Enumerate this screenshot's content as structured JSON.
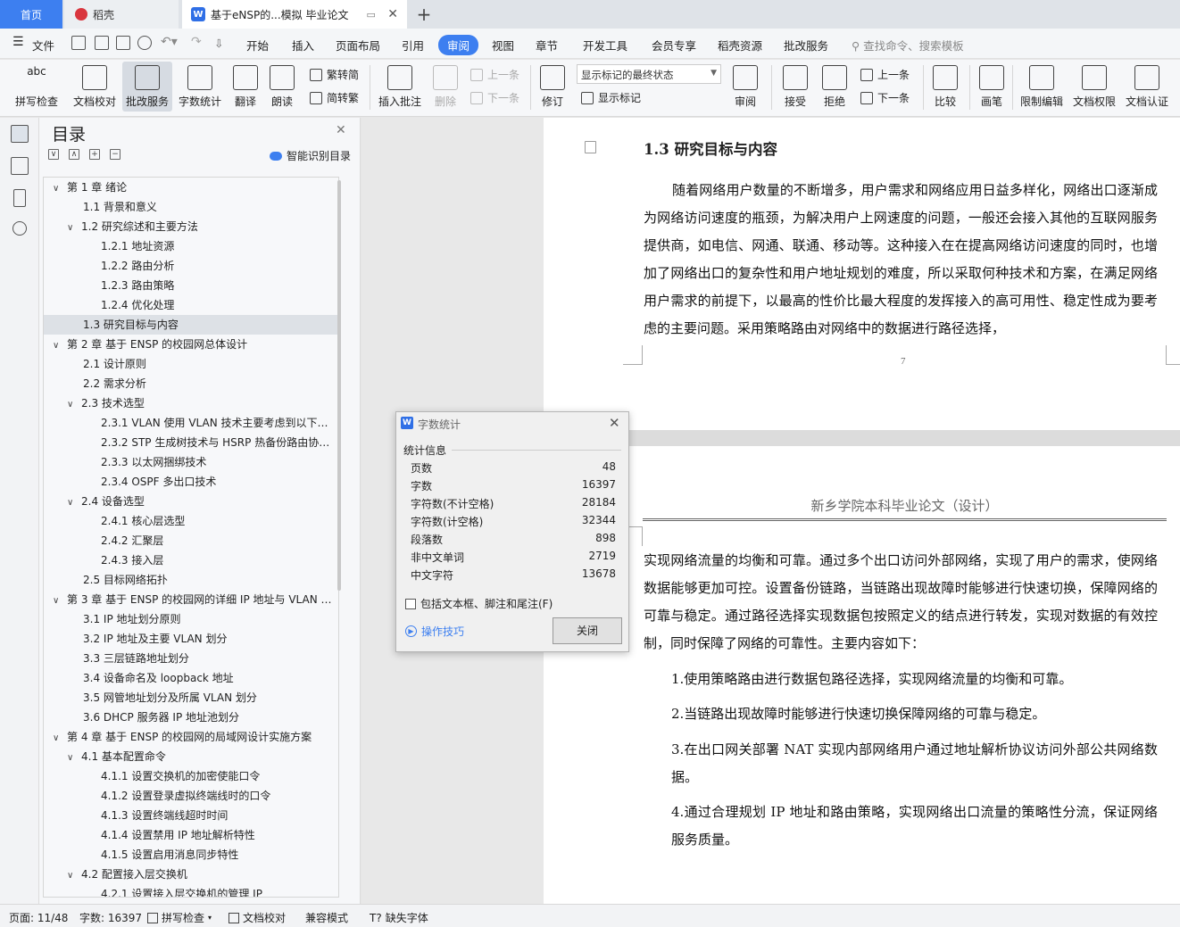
{
  "titlebar": {
    "home_tab": "首页",
    "daoke_tab": "稻壳",
    "doc_tab": "基于eNSP的...模拟 毕业论文",
    "plus": "+"
  },
  "menubar": {
    "file": "文件",
    "items": [
      "开始",
      "插入",
      "页面布局",
      "引用",
      "审阅",
      "视图",
      "章节",
      "开发工具",
      "会员专享",
      "稻壳资源",
      "批改服务"
    ],
    "active": "审阅",
    "search": "查找命令、搜索模板"
  },
  "ribbon": {
    "spell_check": "拼写检查",
    "doc_proof": "文档校对",
    "review_service": "批改服务",
    "word_count": "字数统计",
    "translate": "翻译",
    "read_aloud": "朗读",
    "trad_to_simp": "繁转简",
    "simp_to_trad": "简转繁",
    "insert_comment": "插入批注",
    "delete": "删除",
    "prev_comment": "上一条",
    "next_comment": "下一条",
    "revise": "修订",
    "markup_state": "显示标记的最终状态",
    "show_markup": "显示标记",
    "review": "审阅",
    "accept": "接受",
    "reject": "拒绝",
    "prev_change": "上一条",
    "next_change": "下一条",
    "compare": "比较",
    "pen": "画笔",
    "restrict_edit": "限制编辑",
    "doc_rights": "文档权限",
    "doc_cert": "文档认证"
  },
  "toc": {
    "title": "目录",
    "smart": "智能识别目录",
    "items": [
      {
        "level": 1,
        "text": "第 1 章  绪论",
        "chev": "∨"
      },
      {
        "level": 2,
        "text": "1.1 背景和意义",
        "chev": ""
      },
      {
        "level": 2,
        "text": "1.2 研究综述和主要方法",
        "chev": "∨"
      },
      {
        "level": 3,
        "text": "1.2.1 地址资源",
        "chev": ""
      },
      {
        "level": 3,
        "text": "1.2.2 路由分析",
        "chev": ""
      },
      {
        "level": 3,
        "text": "1.2.3 路由策略",
        "chev": ""
      },
      {
        "level": 3,
        "text": "1.2.4 优化处理",
        "chev": ""
      },
      {
        "level": 2,
        "text": "1.3 研究目标与内容",
        "chev": "",
        "selected": true
      },
      {
        "level": 1,
        "text": "第 2 章  基于 ENSP 的校园网总体设计",
        "chev": "∨"
      },
      {
        "level": 2,
        "text": "2.1 设计原则",
        "chev": ""
      },
      {
        "level": 2,
        "text": "2.2 需求分析",
        "chev": ""
      },
      {
        "level": 2,
        "text": "2.3 技术选型",
        "chev": "∨"
      },
      {
        "level": 3,
        "text": "2.3.1 VLAN  使用 VLAN 技术主要考虑到以下优势：",
        "chev": ""
      },
      {
        "level": 3,
        "text": "2.3.2 STP 生成树技术与 HSRP 热备份路由协议技术",
        "chev": ""
      },
      {
        "level": 3,
        "text": "2.3.3 以太网捆绑技术",
        "chev": ""
      },
      {
        "level": 3,
        "text": "2.3.4 OSPF 多出口技术",
        "chev": ""
      },
      {
        "level": 2,
        "text": "2.4 设备选型",
        "chev": "∨"
      },
      {
        "level": 3,
        "text": "2.4.1 核心层选型",
        "chev": ""
      },
      {
        "level": 3,
        "text": "2.4.2 汇聚层",
        "chev": ""
      },
      {
        "level": 3,
        "text": "2.4.3 接入层",
        "chev": ""
      },
      {
        "level": 2,
        "text": "2.5 目标网络拓扑",
        "chev": ""
      },
      {
        "level": 1,
        "text": "第 3 章  基于 ENSP 的校园网的详细 IP 地址与 VLAN 划分",
        "chev": "∨"
      },
      {
        "level": 2,
        "text": "3.1 IP 地址划分原则",
        "chev": ""
      },
      {
        "level": 2,
        "text": "3.2 IP 地址及主要 VLAN 划分",
        "chev": ""
      },
      {
        "level": 2,
        "text": "3.3 三层链路地址划分",
        "chev": ""
      },
      {
        "level": 2,
        "text": "3.4 设备命名及 loopback 地址",
        "chev": ""
      },
      {
        "level": 2,
        "text": "3.5 网管地址划分及所属 VLAN 划分",
        "chev": ""
      },
      {
        "level": 2,
        "text": "3.6 DHCP 服务器 IP 地址池划分",
        "chev": ""
      },
      {
        "level": 1,
        "text": "第 4 章  基于 ENSP 的校园网的局域网设计实施方案",
        "chev": "∨"
      },
      {
        "level": 2,
        "text": "4.1 基本配置命令",
        "chev": "∨"
      },
      {
        "level": 3,
        "text": "4.1.1 设置交换机的加密使能口令",
        "chev": ""
      },
      {
        "level": 3,
        "text": "4.1.2 设置登录虚拟终端线时的口令",
        "chev": ""
      },
      {
        "level": 3,
        "text": "4.1.3 设置终端线超时时间",
        "chev": ""
      },
      {
        "level": 3,
        "text": "4.1.4 设置禁用 IP 地址解析特性",
        "chev": ""
      },
      {
        "level": 3,
        "text": "4.1.5 设置启用消息同步特性",
        "chev": ""
      },
      {
        "level": 2,
        "text": "4.2 配置接入层交换机",
        "chev": "∨"
      },
      {
        "level": 3,
        "text": "4.2.1 设置接入层交换机的管理 IP",
        "chev": ""
      }
    ]
  },
  "document": {
    "heading": "1.3 研究目标与内容",
    "para1": "随着网络用户数量的不断增多，用户需求和网络应用日益多样化，网络出口逐渐成为网络访问速度的瓶颈，为解决用户上网速度的问题，一般还会接入其他的互联网服务提供商，如电信、网通、联通、移动等。这种接入在在提高网络访问速度的同时，也增加了网络出口的复杂性和用户地址规划的难度，所以采取何种技术和方案，在满足网络用户需求的前提下，以最高的性价比最大程度的发挥接入的高可用性、稳定性成为要考虑的主要问题。采用策略路由对网络中的数据进行路径选择，",
    "page_number": "7",
    "header2": "新乡学院本科毕业论文（设计）",
    "para2": "实现网络流量的均衡和可靠。通过多个出口访问外部网络，实现了用户的需求，使网络数据能够更加可控。设置备份链路，当链路出现故障时能够进行快速切换，保障网络的可靠与稳定。通过路径选择实现数据包按照定义的结点进行转发，实现对数据的有效控制，同时保障了网络的可靠性。主要内容如下：",
    "list": [
      "1.使用策略路由进行数据包路径选择，实现网络流量的均衡和可靠。",
      "2.当链路出现故障时能够进行快速切换保障网络的可靠与稳定。",
      "3.在出口网关部署 NAT 实现内部网络用户通过地址解析协议访问外部公共网络数据。",
      "4.通过合理规划 IP 地址和路由策略，实现网络出口流量的策略性分流，保证网络服务质量。"
    ]
  },
  "dialog": {
    "title": "字数统计",
    "section": "统计信息",
    "rows": [
      {
        "label": "页数",
        "value": "48"
      },
      {
        "label": "字数",
        "value": "16397"
      },
      {
        "label": "字符数(不计空格)",
        "value": "28184"
      },
      {
        "label": "字符数(计空格)",
        "value": "32344"
      },
      {
        "label": "段落数",
        "value": "898"
      },
      {
        "label": "非中文单词",
        "value": "2719"
      },
      {
        "label": "中文字符",
        "value": "13678"
      }
    ],
    "checkbox": "包括文本框、脚注和尾注(F)",
    "tips": "操作技巧",
    "close": "关闭"
  },
  "statusbar": {
    "page": "页面: 11/48",
    "words": "字数: 16397",
    "spell": "拼写检查",
    "proof": "文档校对",
    "compat": "兼容模式",
    "missing_font": "缺失字体"
  }
}
